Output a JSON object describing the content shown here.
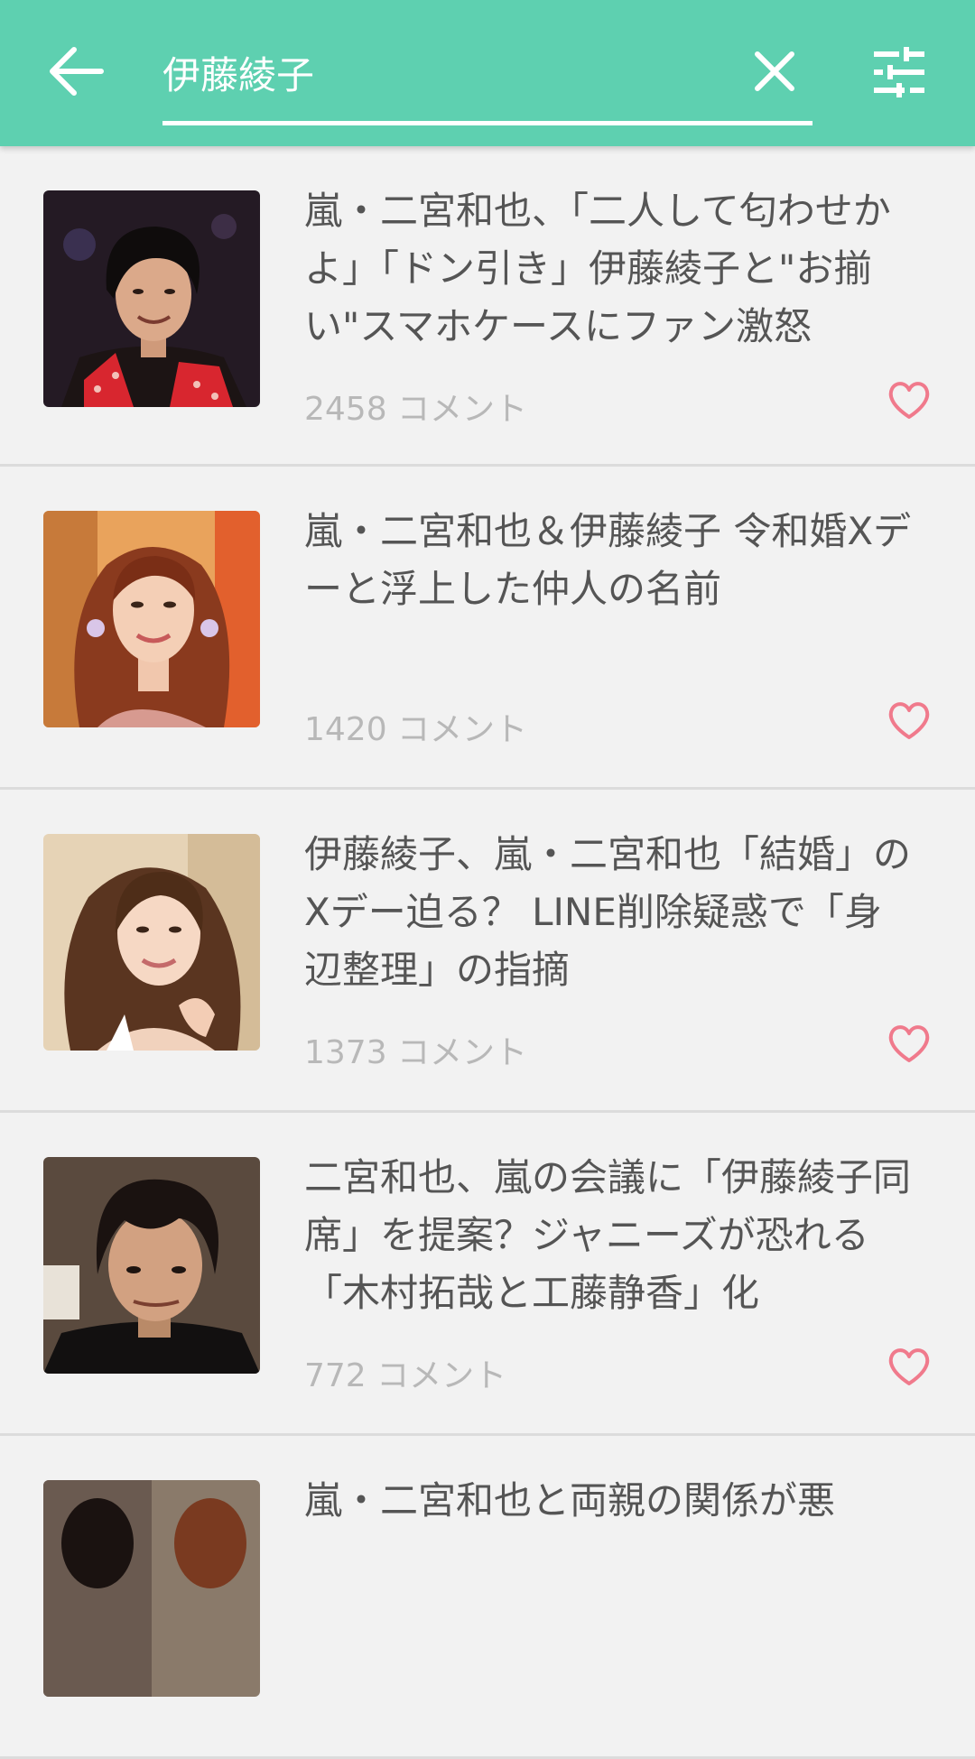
{
  "search": {
    "query": "伊藤綾子"
  },
  "colors": {
    "header": "#5ed0b0",
    "heart": "#f07a8c",
    "title_text": "#555555",
    "meta_text": "#b8b8b8"
  },
  "icons": {
    "back": "arrow-left-icon",
    "clear": "close-icon",
    "filter": "sliders-icon",
    "like": "heart-outline-icon"
  },
  "articles": [
    {
      "title": "嵐・二宮和也、「二人して匂わせかよ」「ドン引き」伊藤綾子と\"お揃い\"スマホケースにファン激怒",
      "comments": "2458 コメント"
    },
    {
      "title": " 嵐・二宮和也＆伊藤綾子 令和婚Xデーと浮上した仲人の名前",
      "comments": "1420 コメント"
    },
    {
      "title": "伊藤綾子、嵐・二宮和也「結婚」のXデー迫る？ LINE削除疑惑で「身辺整理」の指摘",
      "comments": "1373 コメント"
    },
    {
      "title": "二宮和也、嵐の会議に「伊藤綾子同席」を提案？ジャニーズが恐れる「木村拓哉と工藤静香」化",
      "comments": "772 コメント"
    },
    {
      "title": "嵐・二宮和也と両親の関係が悪",
      "comments": ""
    }
  ]
}
